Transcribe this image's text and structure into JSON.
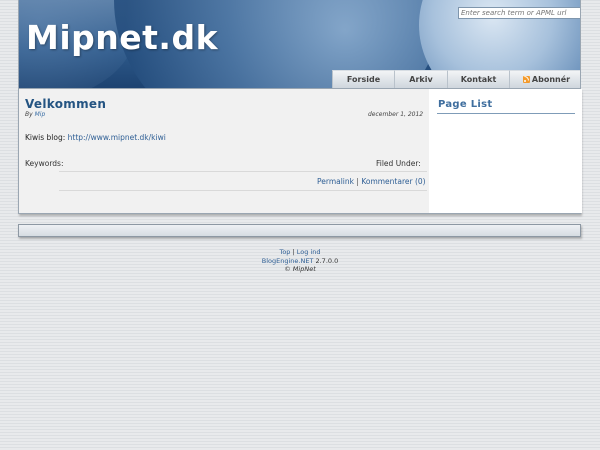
{
  "header": {
    "site_title": "Mipnet.dk",
    "search_placeholder": "Enter search term or APML url",
    "nav": [
      {
        "label": "Forside"
      },
      {
        "label": "Arkiv"
      },
      {
        "label": "Kontakt"
      },
      {
        "label": "Abonnér",
        "icon": "rss-icon"
      }
    ]
  },
  "post": {
    "title": "Velkommen",
    "by_label": "By",
    "author": "Mip",
    "date": "december 1, 2012",
    "body_label": "Kiwis blog:",
    "body_link": "http://www.mipnet.dk/kiwi",
    "keywords_label": "Keywords:",
    "filed_label": "Filed Under:",
    "permalink": "Permalink",
    "separator": "|",
    "comments": "Kommentarer (0)"
  },
  "sidebar": {
    "title": "Page List"
  },
  "footer": {
    "top": "Top",
    "sep": "|",
    "login": "Log ind",
    "engine": "BlogEngine.NET",
    "version": "2.7.0.0",
    "copyright": "© MipNet"
  },
  "colors": {
    "accent": "#245482",
    "link": "#2f5f95",
    "header_blue": "#2f5b8c"
  }
}
